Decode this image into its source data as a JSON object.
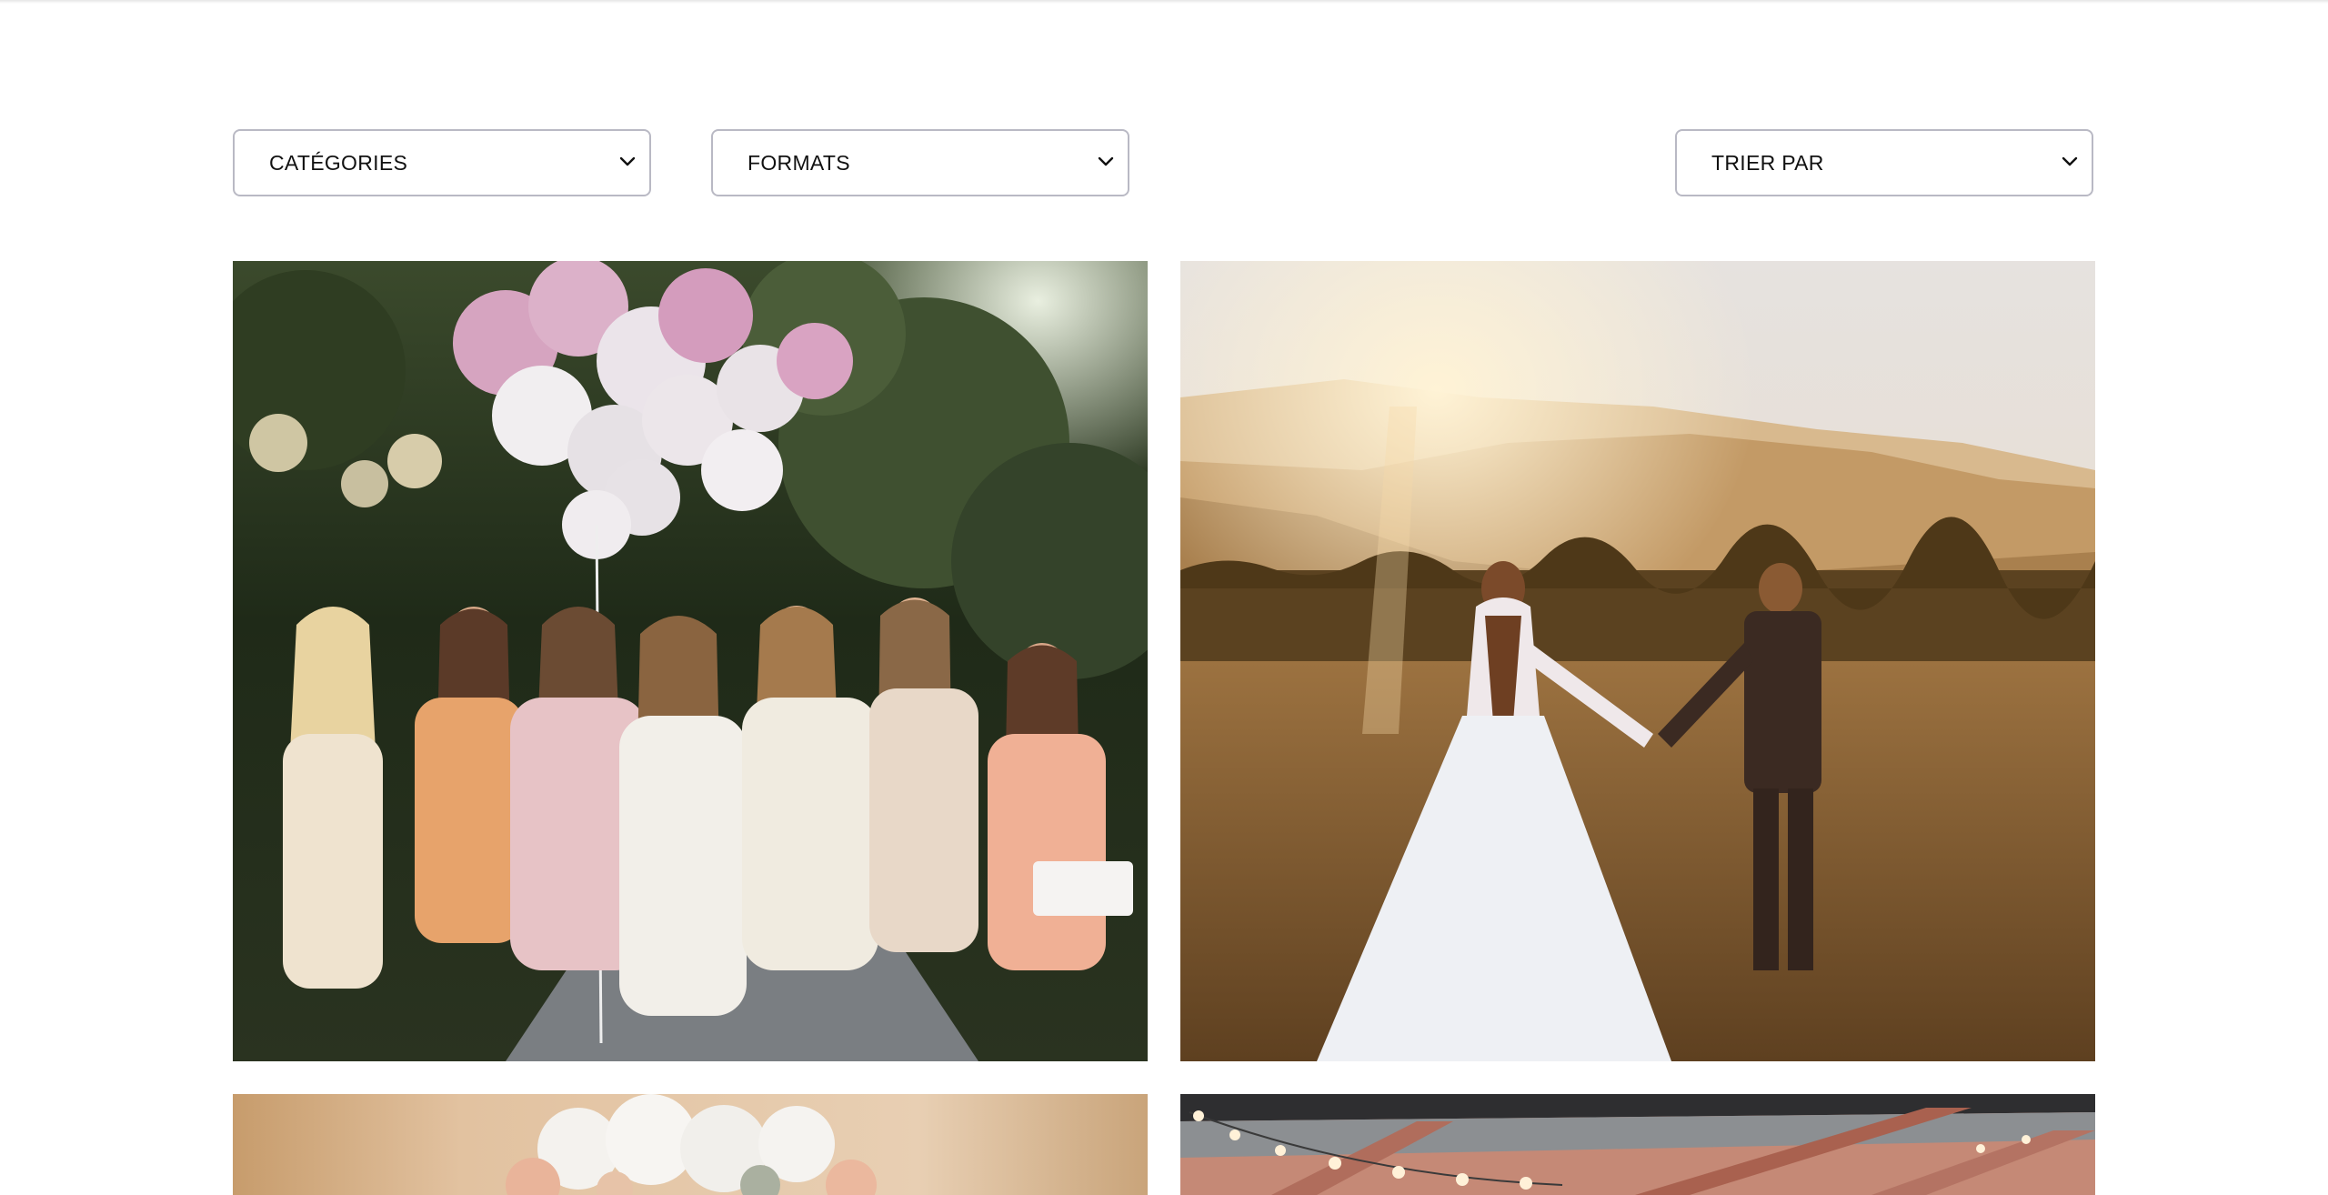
{
  "filters": {
    "categories_label": "CATÉGORIES",
    "formats_label": "FORMATS",
    "sort_label": "TRIER PAR",
    "chevron_icon": "chevron-down-icon"
  },
  "gallery": {
    "photos": [
      {
        "subject": "bridesmaids-with-balloons"
      },
      {
        "subject": "couple-in-field-at-sunset"
      },
      {
        "subject": "bridal-bouquet"
      },
      {
        "subject": "reception-string-lights"
      }
    ]
  },
  "colors": {
    "border": "#b9b9c4",
    "text": "#111111",
    "background": "#ffffff"
  }
}
